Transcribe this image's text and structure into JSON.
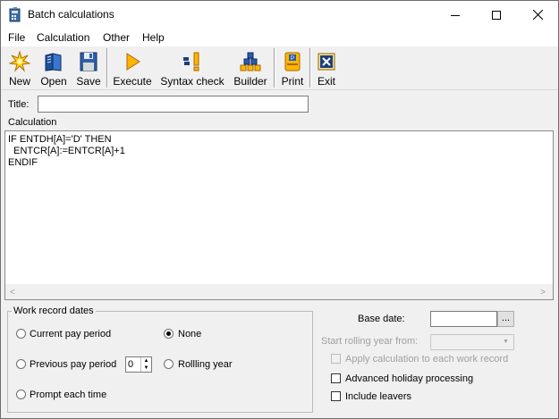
{
  "window": {
    "title": "Batch calculations"
  },
  "menu": {
    "items": [
      "File",
      "Calculation",
      "Other",
      "Help"
    ]
  },
  "toolbar": {
    "new_label": "New",
    "open_label": "Open",
    "save_label": "Save",
    "execute_label": "Execute",
    "syntax_label": "Syntax check",
    "builder_label": "Builder",
    "print_label": "Print",
    "exit_label": "Exit"
  },
  "form": {
    "title_label": "Title:",
    "title_value": "",
    "calculation_label": "Calculation",
    "calculation_text": "IF ENTDH[A]='D' THEN\n  ENTCR[A]:=ENTCR[A]+1\nENDIF"
  },
  "work_record_dates": {
    "legend": "Work record dates",
    "current_pay_period": "Current pay period",
    "none": "None",
    "previous_pay_period": "Previous pay period",
    "previous_count": "0",
    "rolling_year": "Rollling year",
    "prompt_each_time": "Prompt each time",
    "selected": "None"
  },
  "options": {
    "base_date_label": "Base date:",
    "base_date_value": "",
    "ellipsis": "...",
    "start_rolling_label": "Start rolling year from:",
    "apply_calc_label": "Apply calculation to each work record",
    "advanced_holiday_label": "Advanced holiday processing",
    "include_leavers_label": "Include leavers"
  }
}
